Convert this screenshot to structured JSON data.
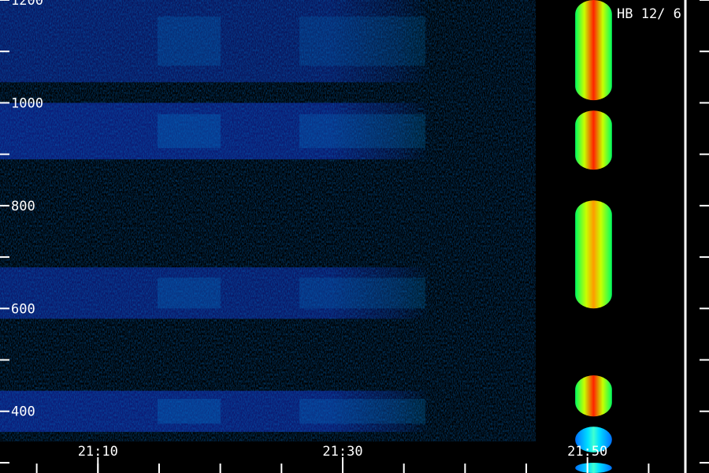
{
  "chart_data": {
    "type": "heatmap",
    "title": "",
    "station_label": "HB 12/ 6",
    "xlabel": "",
    "ylabel": "",
    "x_ticks": [
      {
        "time": "21:10",
        "label": "21:10"
      },
      {
        "time": "21:30",
        "label": "21:30"
      },
      {
        "time": "21:50",
        "label": "21:50"
      }
    ],
    "x_minor_ticks": [
      "21:00",
      "21:05",
      "21:10",
      "21:15",
      "21:20",
      "21:25",
      "21:30",
      "21:35",
      "21:40",
      "21:45",
      "21:50",
      "21:55"
    ],
    "xlim": [
      "21:02",
      "21:58"
    ],
    "y_ticks": [
      400,
      600,
      800,
      1000,
      1200
    ],
    "y_minor_ticks": [
      300,
      500,
      700,
      900,
      1100
    ],
    "ylim": [
      280,
      1200
    ],
    "y_unit": "",
    "colors": {
      "background": "#000000",
      "low": "#0a1aa8",
      "mid": "#00b4ff",
      "green": "#00ff40",
      "yellow": "#ffff00",
      "high": "#ff1a00",
      "axis": "#ffffff"
    },
    "bands": [
      {
        "from": 1040,
        "to": 1200,
        "level": 0.45
      },
      {
        "from": 890,
        "to": 1000,
        "level": 0.55
      },
      {
        "from": 580,
        "to": 680,
        "level": 0.5
      },
      {
        "from": 360,
        "to": 440,
        "level": 0.55
      }
    ],
    "burst": {
      "start": "21:49",
      "end": "21:52",
      "segments": [
        {
          "from": 1005,
          "to": 1200,
          "peak": 1.0
        },
        {
          "from": 870,
          "to": 985,
          "peak": 0.95
        },
        {
          "from": 600,
          "to": 810,
          "peak": 0.8
        },
        {
          "from": 390,
          "to": 470,
          "peak": 0.9
        },
        {
          "from": 320,
          "to": 370,
          "peak": 0.45
        },
        {
          "from": 280,
          "to": 300,
          "peak": 0.5
        }
      ]
    }
  }
}
